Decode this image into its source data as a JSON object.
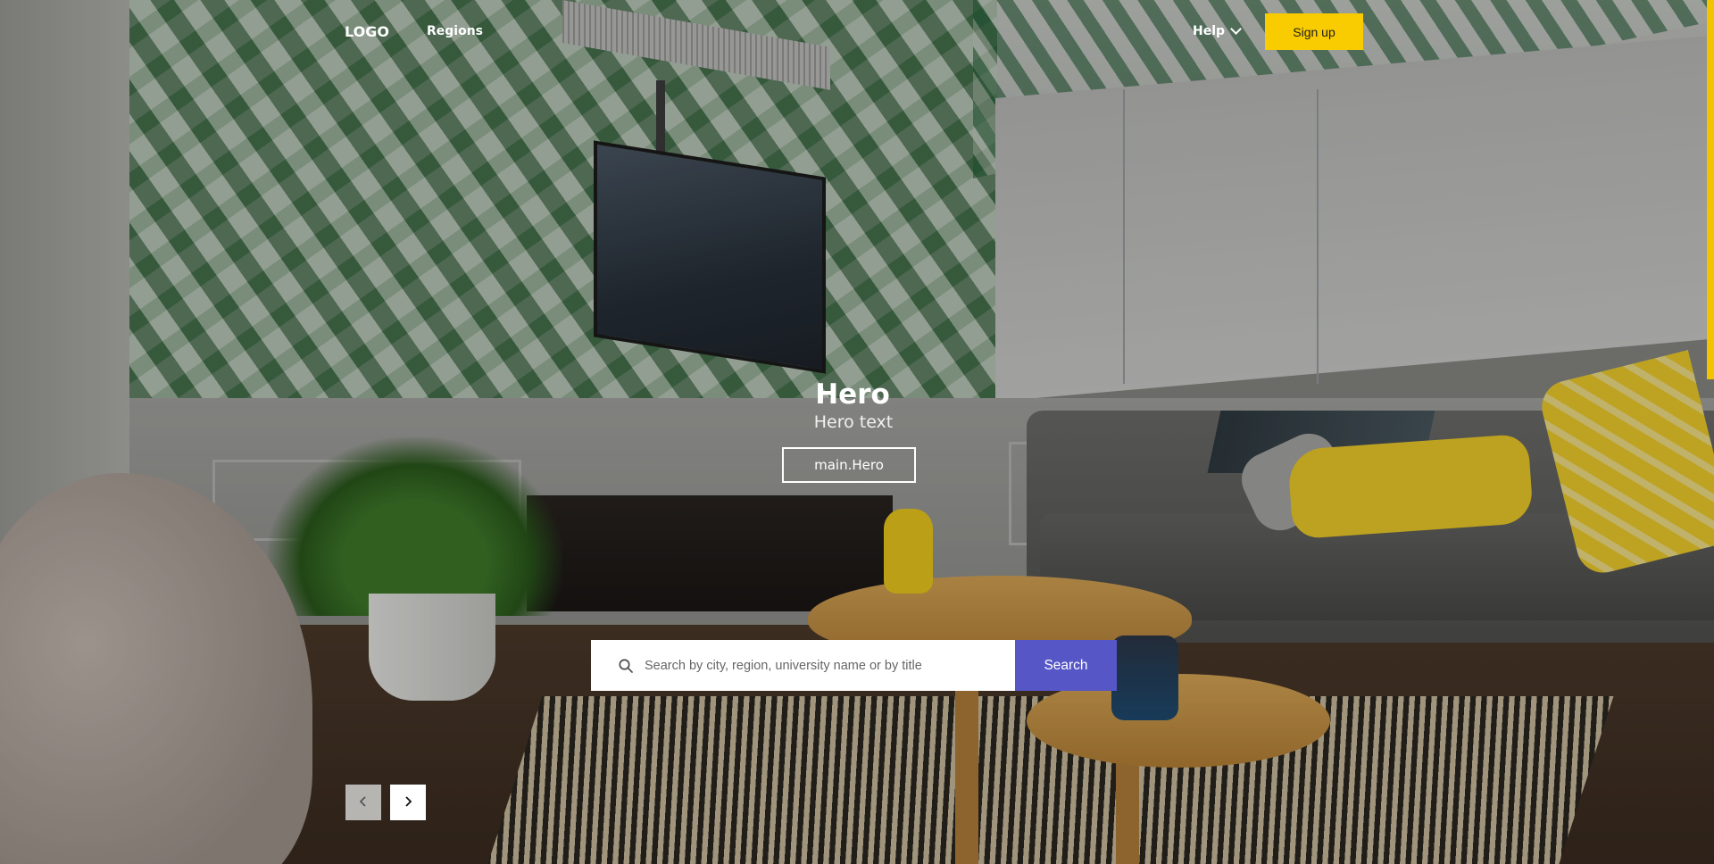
{
  "header": {
    "logo": "LOGO",
    "nav_regions": "Regions",
    "help_label": "Help",
    "signup_label": "Sign up"
  },
  "hero": {
    "title": "Hero",
    "text": "Hero text",
    "button_label": "main.Hero"
  },
  "search": {
    "placeholder": "Search by city, region, university name or by title",
    "button_label": "Search"
  },
  "carousel": {
    "prev_icon": "chevron-left-icon",
    "next_icon": "chevron-right-icon"
  },
  "colors": {
    "accent_yellow": "#f8cc00",
    "search_button": "#5756c7"
  },
  "icons": {
    "search": "search-icon",
    "help_dropdown": "chevron-down-icon"
  }
}
